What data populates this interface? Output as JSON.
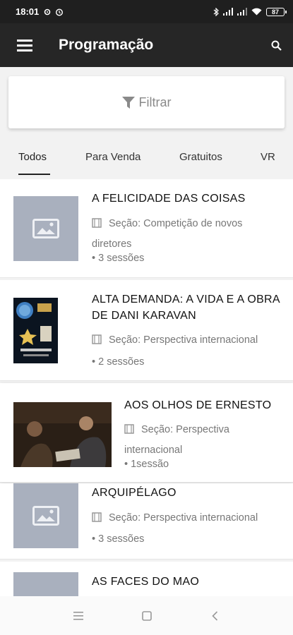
{
  "status_bar": {
    "time": "18:01",
    "battery": "87"
  },
  "app_bar": {
    "title": "Programação"
  },
  "filter": {
    "label": "Filtrar"
  },
  "tabs": [
    {
      "label": "Todos",
      "selected": true
    },
    {
      "label": "Para Venda"
    },
    {
      "label": "Gratuitos"
    },
    {
      "label": "VR"
    }
  ],
  "items": [
    {
      "title": "A FELICIDADE DAS COISAS",
      "section": "Seção: Competição de novos diretores",
      "sessions": "• 3 sessões",
      "image": "placeholder"
    },
    {
      "title": "ALTA DEMANDA: A VIDA E A OBRA DE DANI KARAVAN",
      "section": "Seção: Perspectiva internacional",
      "sessions": "• 2 sessões",
      "image": "poster"
    },
    {
      "title": "AOS OLHOS DE ERNESTO",
      "section": "Seção: Perspectiva internacional",
      "sessions": "• 1sessão",
      "image": "photo"
    },
    {
      "title": "ARQUIPÉLAGO",
      "section": "Seção: Perspectiva internacional",
      "sessions": "• 3 sessões",
      "image": "placeholder"
    },
    {
      "title": "AS FACES DO MAO",
      "image": "placeholder"
    }
  ],
  "colors": {
    "app_bar": "#262626",
    "status_bar": "#1f1f1f",
    "placeholder": "#a9b0be"
  }
}
